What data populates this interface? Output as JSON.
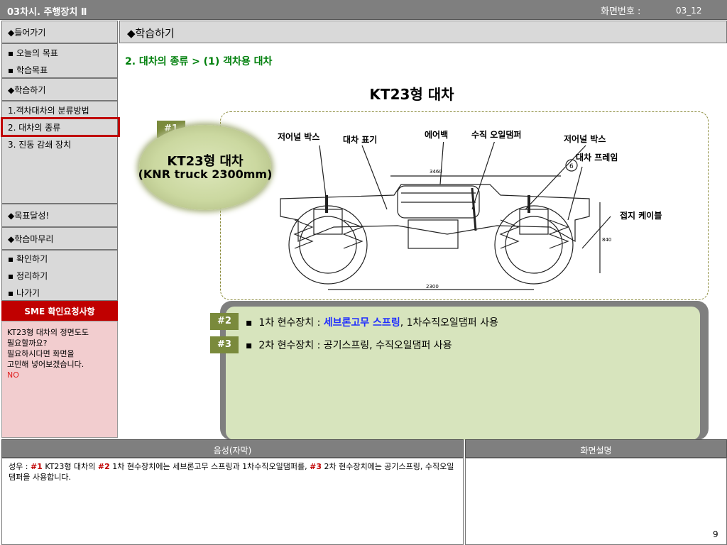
{
  "header": {
    "title": "03차시. 주행장치 Ⅱ",
    "screen_label": "화면번호 :",
    "screen_number": "03_12"
  },
  "sidebar": {
    "intro_label": "◆들어가기",
    "intro_items": [
      "▪ 오늘의 목표",
      "▪ 학습목표"
    ],
    "learn_label": "◆학습하기",
    "learn_items": [
      "1.객차대차의 분류방법",
      "2. 대차의 종류",
      "3. 진동 감쇄 장치"
    ],
    "goal_label": "◆목표달성!",
    "wrap_label": "◆학습마무리",
    "wrap_items": [
      "▪ 확인하기",
      "▪ 정리하기",
      "▪ 나가기"
    ],
    "sme_title": "SME 확인요청사항",
    "sme_lines": [
      "KT23형 대차의 정면도도",
      "필요할까요?",
      "필요하시다면 화면을",
      "고민해 넣어보겠습니다."
    ],
    "sme_answer": "NO"
  },
  "main": {
    "header": "◆학습하기",
    "section_title": "2. 대차의 종류 > (1) 객차용 대차",
    "center_title": "KT23형 대차"
  },
  "diagram": {
    "badge1": "#1",
    "ellipse_title": "KT23형 대차",
    "ellipse_subtitle": "(KNR truck 2300mm)",
    "labels": {
      "journal_box_left": "저어널 박스",
      "bogie_mark": "대차 표기",
      "air_bag": "에어백",
      "vertical_damper": "수직 오일댐퍼",
      "journal_box_right": "저어널 박스",
      "bogie_frame": "대차 프레임",
      "ground_cable": "접지 케이블"
    },
    "dims": {
      "top": "3460",
      "bottom": "2300",
      "side": "840",
      "callout": "6"
    }
  },
  "content": {
    "badge2": "#2",
    "badge3": "#3",
    "line1_prefix": "1차 현수장치 : ",
    "line1_highlight": "세브론고무 스프링",
    "line1_suffix": ", 1차수직오일댐퍼 사용",
    "line2": "2차 현수장치 : 공기스프링, 수직오일댐퍼 사용"
  },
  "bottom": {
    "narration_header": "음성(자막)",
    "description_header": "화면설명",
    "narr_prefix": "성우 : ",
    "narr_tag1": "#1",
    "narr_text1": " KT23형  대차의 ",
    "narr_tag2": "#2",
    "narr_text2": " 1차 현수장치에는 세브론고무 스프링과 1차수직오일댐퍼를, ",
    "narr_tag3": "#3",
    "narr_text3": " 2차 현수장치에는 공기스프링, 수직오일댐퍼을 사용합니다.",
    "page_number": "9"
  },
  "colors": {
    "topbar": "#7f7f7f",
    "sidebar_bg": "#d9d9d9",
    "active_outline": "#c00000",
    "section_green": "#00800c",
    "badge_olive": "#7a8a3c",
    "panel_green": "#d7e4bd",
    "sme_red": "#c00000",
    "sme_pink": "#f2cdcf",
    "highlight_blue": "#1f2dff"
  }
}
